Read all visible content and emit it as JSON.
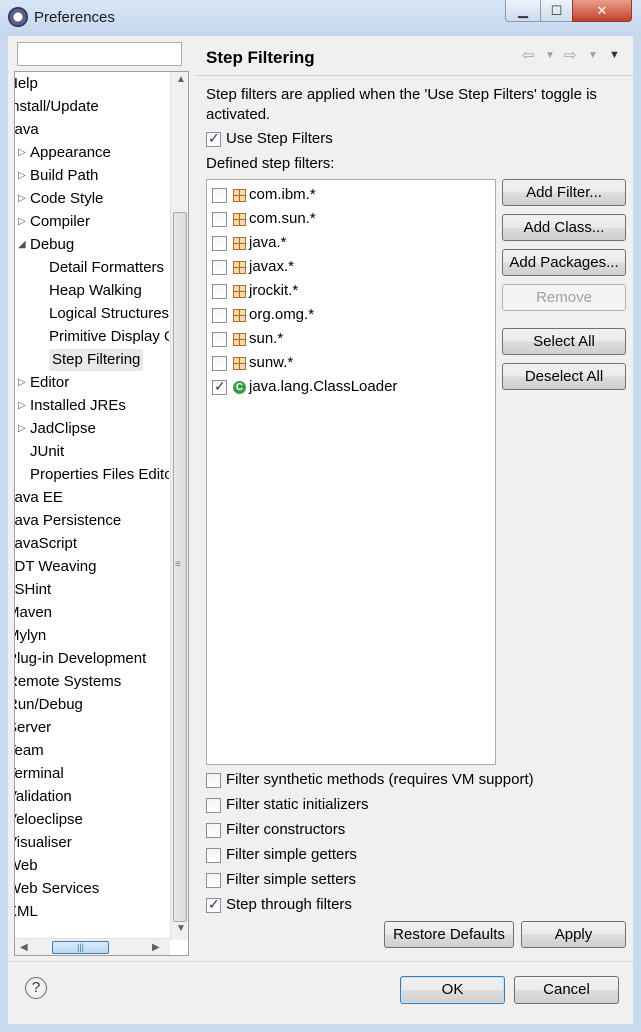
{
  "window": {
    "title": "Preferences"
  },
  "sidebar": {
    "filter_placeholder": "",
    "items": [
      {
        "label": "Help",
        "toggle": "",
        "indent": 0,
        "clip": 1
      },
      {
        "label": "Install/Update",
        "toggle": "",
        "indent": 0,
        "clip": 1
      },
      {
        "label": "Java",
        "toggle": "",
        "indent": 0,
        "clip": 1
      },
      {
        "label": "Appearance",
        "toggle": "right",
        "indent": 1
      },
      {
        "label": "Build Path",
        "toggle": "right",
        "indent": 1
      },
      {
        "label": "Code Style",
        "toggle": "right",
        "indent": 1
      },
      {
        "label": "Compiler",
        "toggle": "right",
        "indent": 1
      },
      {
        "label": "Debug",
        "toggle": "down",
        "indent": 1
      },
      {
        "label": "Detail Formatters",
        "toggle": "",
        "indent": 2
      },
      {
        "label": "Heap Walking",
        "toggle": "",
        "indent": 2
      },
      {
        "label": "Logical Structures",
        "toggle": "",
        "indent": 2
      },
      {
        "label": "Primitive Display Options",
        "toggle": "",
        "indent": 2
      },
      {
        "label": "Step Filtering",
        "toggle": "",
        "indent": 2,
        "selected": true
      },
      {
        "label": "Editor",
        "toggle": "right",
        "indent": 1
      },
      {
        "label": "Installed JREs",
        "toggle": "right",
        "indent": 1
      },
      {
        "label": "JadClipse",
        "toggle": "right",
        "indent": 1
      },
      {
        "label": "JUnit",
        "toggle": "",
        "indent": 1
      },
      {
        "label": "Properties Files Editor",
        "toggle": "",
        "indent": 1
      },
      {
        "label": "Java EE",
        "toggle": "",
        "indent": 0,
        "clip": 1
      },
      {
        "label": "Java Persistence",
        "toggle": "",
        "indent": 0,
        "clip": 1
      },
      {
        "label": "JavaScript",
        "toggle": "",
        "indent": 0,
        "clip": 1
      },
      {
        "label": "JDT Weaving",
        "toggle": "",
        "indent": 0,
        "clip": 1
      },
      {
        "label": "JSHint",
        "toggle": "",
        "indent": 0,
        "clip": 1
      },
      {
        "label": "Maven",
        "toggle": "",
        "indent": 0,
        "clip": 1
      },
      {
        "label": "Mylyn",
        "toggle": "",
        "indent": 0,
        "clip": 1
      },
      {
        "label": "Plug-in Development",
        "toggle": "",
        "indent": 0,
        "clip": 1
      },
      {
        "label": "Remote Systems",
        "toggle": "",
        "indent": 0,
        "clip": 1
      },
      {
        "label": "Run/Debug",
        "toggle": "",
        "indent": 0,
        "clip": 1
      },
      {
        "label": "Server",
        "toggle": "",
        "indent": 0,
        "clip": 1
      },
      {
        "label": "Team",
        "toggle": "",
        "indent": 0,
        "clip": 1
      },
      {
        "label": "Terminal",
        "toggle": "",
        "indent": 0,
        "clip": 1
      },
      {
        "label": "Validation",
        "toggle": "",
        "indent": 0,
        "clip": 1
      },
      {
        "label": "Veloeclipse",
        "toggle": "",
        "indent": 0,
        "clip": 1
      },
      {
        "label": "Visualiser",
        "toggle": "",
        "indent": 0,
        "clip": 1
      },
      {
        "label": "Web",
        "toggle": "",
        "indent": 0,
        "clip": 1
      },
      {
        "label": "Web Services",
        "toggle": "",
        "indent": 0,
        "clip": 1
      },
      {
        "label": "XML",
        "toggle": "",
        "indent": 0,
        "clip": 1
      }
    ]
  },
  "page": {
    "title": "Step Filtering",
    "description": "Step filters are applied when the 'Use Step Filters' toggle is activated.",
    "use_step_filters": {
      "label": "Use Step Filters",
      "checked": true
    },
    "defined_label": "Defined step filters:",
    "filters": [
      {
        "name": "com.ibm.*",
        "checked": false,
        "icon": "package-icon"
      },
      {
        "name": "com.sun.*",
        "checked": false,
        "icon": "package-icon"
      },
      {
        "name": "java.*",
        "checked": false,
        "icon": "package-icon"
      },
      {
        "name": "javax.*",
        "checked": false,
        "icon": "package-icon"
      },
      {
        "name": "jrockit.*",
        "checked": false,
        "icon": "package-icon"
      },
      {
        "name": "org.omg.*",
        "checked": false,
        "icon": "package-icon"
      },
      {
        "name": "sun.*",
        "checked": false,
        "icon": "package-icon"
      },
      {
        "name": "sunw.*",
        "checked": false,
        "icon": "package-icon"
      },
      {
        "name": "java.lang.ClassLoader",
        "checked": true,
        "icon": "class-icon"
      }
    ],
    "buttons": {
      "add_filter": "Add Filter...",
      "add_class": "Add Class...",
      "add_packages": "Add Packages...",
      "remove": "Remove",
      "select_all": "Select All",
      "deselect_all": "Deselect All"
    },
    "options": [
      {
        "label": "Filter synthetic methods (requires VM support)",
        "checked": false
      },
      {
        "label": "Filter static initializers",
        "checked": false
      },
      {
        "label": "Filter constructors",
        "checked": false
      },
      {
        "label": "Filter simple getters",
        "checked": false
      },
      {
        "label": "Filter simple setters",
        "checked": false
      },
      {
        "label": "Step through filters",
        "checked": true
      }
    ],
    "restore_defaults": "Restore Defaults",
    "apply": "Apply"
  },
  "footer": {
    "ok": "OK",
    "cancel": "Cancel"
  }
}
